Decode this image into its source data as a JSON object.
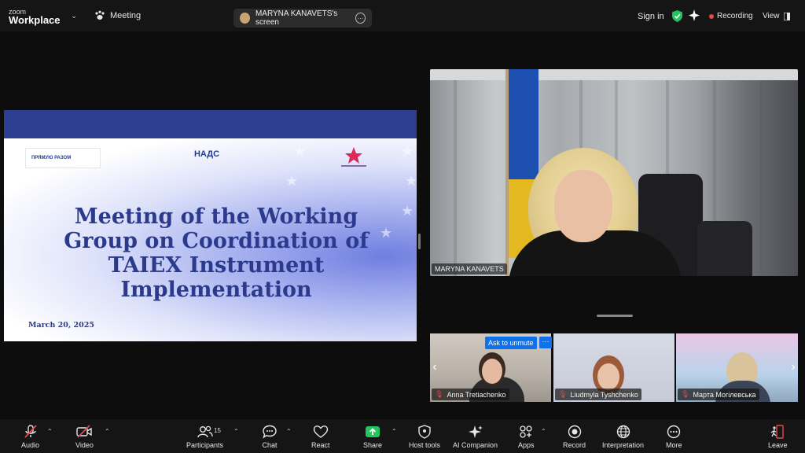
{
  "app": {
    "brand_top": "zoom",
    "brand_bottom": "Workplace"
  },
  "header": {
    "meeting_label": "Meeting",
    "share_label": "MARYNA KANAVETS's screen",
    "sign_in": "Sign in",
    "recording": "Recording",
    "view": "View"
  },
  "slide": {
    "logo1_title": "ПРЯМУЮ РАЗОМ",
    "logo2_title": "НАДС",
    "title": "Meeting of the Working Group on Coordination of TAIEX Instrument Implementation",
    "date": "March 20, 2025"
  },
  "speaker": {
    "name": "MARYNA KANAVETS"
  },
  "thumbnails": [
    {
      "name": "Anna Tretiachenko"
    },
    {
      "name": "Liudmyla Tyshchenko"
    },
    {
      "name": "Марта Могілевська"
    }
  ],
  "ask_unmute": "Ask to unmute",
  "ask_more": "···",
  "toolbar": {
    "audio": "Audio",
    "video": "Video",
    "participants": "Participants",
    "participants_count": "15",
    "chat": "Chat",
    "react": "React",
    "share": "Share",
    "host_tools": "Host tools",
    "ai_companion": "AI Companion",
    "apps": "Apps",
    "record": "Record",
    "interpretation": "Interpretation",
    "more": "More",
    "leave": "Leave"
  },
  "colors": {
    "accent": "#0e72ed",
    "share_green": "#22c55e",
    "danger": "#e5484d",
    "slide_navy": "#2b3a8c"
  }
}
